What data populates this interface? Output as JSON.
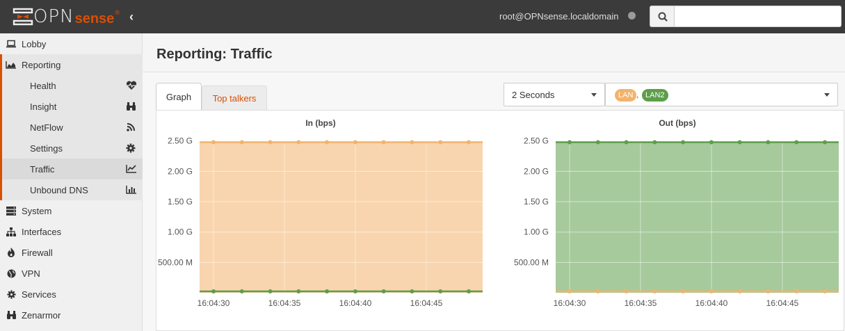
{
  "header": {
    "logo_text": "OPN",
    "logo_sub": "sense",
    "logo_reg": "®",
    "collapse_glyph": "‹",
    "user": "root@OPNsense.localdomain",
    "search_placeholder": ""
  },
  "sidebar": {
    "items": [
      {
        "label": "Lobby",
        "icon": "laptop-icon"
      },
      {
        "label": "Reporting",
        "icon": "area-chart-icon"
      },
      {
        "label": "System",
        "icon": "server-icon"
      },
      {
        "label": "Interfaces",
        "icon": "sitemap-icon"
      },
      {
        "label": "Firewall",
        "icon": "fire-icon"
      },
      {
        "label": "VPN",
        "icon": "globe-icon"
      },
      {
        "label": "Services",
        "icon": "cog-icon"
      },
      {
        "label": "Zenarmor",
        "icon": "binoculars-icon"
      }
    ],
    "reporting_sub": [
      {
        "label": "Health",
        "icon": "heartbeat-icon"
      },
      {
        "label": "Insight",
        "icon": "binoculars-icon"
      },
      {
        "label": "NetFlow",
        "icon": "rss-icon"
      },
      {
        "label": "Settings",
        "icon": "cog-icon"
      },
      {
        "label": "Traffic",
        "icon": "line-chart-icon",
        "active": true
      },
      {
        "label": "Unbound DNS",
        "icon": "bar-chart-icon"
      }
    ]
  },
  "page": {
    "title": "Reporting: Traffic",
    "tabs": [
      {
        "label": "Graph",
        "active": true
      },
      {
        "label": "Top talkers",
        "active": false
      }
    ],
    "interval": "2 Seconds",
    "interfaces": [
      "LAN",
      "LAN2"
    ],
    "interfaces_separator": ","
  },
  "colors": {
    "accent": "#d94f00",
    "lan": "#f2b36c",
    "lan2": "#5d9e4a"
  },
  "chart_data": [
    {
      "type": "area",
      "title": "In (bps)",
      "yticks": [
        "2.50 G",
        "2.00 G",
        "1.50 G",
        "1.00 G",
        "500.00 M"
      ],
      "xticks": [
        "16:04:30",
        "16:04:35",
        "16:04:40",
        "16:04:45"
      ],
      "ylim": [
        0,
        2600000000
      ],
      "x": [
        "16:04:30",
        "16:04:32",
        "16:04:34",
        "16:04:36",
        "16:04:38",
        "16:04:40",
        "16:04:42",
        "16:04:44",
        "16:04:46",
        "16:04:48"
      ],
      "series": [
        {
          "name": "LAN",
          "color": "#f2b36c",
          "values": [
            2480000000,
            2480000000,
            2480000000,
            2480000000,
            2480000000,
            2480000000,
            2480000000,
            2480000000,
            2480000000,
            2480000000
          ]
        },
        {
          "name": "LAN2",
          "color": "#5d9e4a",
          "values": [
            0,
            0,
            0,
            0,
            0,
            0,
            0,
            0,
            0,
            0
          ]
        }
      ]
    },
    {
      "type": "area",
      "title": "Out (bps)",
      "yticks": [
        "2.50 G",
        "2.00 G",
        "1.50 G",
        "1.00 G",
        "500.00 M"
      ],
      "xticks": [
        "16:04:30",
        "16:04:35",
        "16:04:40",
        "16:04:45"
      ],
      "ylim": [
        0,
        2600000000
      ],
      "x": [
        "16:04:30",
        "16:04:32",
        "16:04:34",
        "16:04:36",
        "16:04:38",
        "16:04:40",
        "16:04:42",
        "16:04:44",
        "16:04:46",
        "16:04:48"
      ],
      "series": [
        {
          "name": "LAN2",
          "color": "#5d9e4a",
          "values": [
            2480000000,
            2480000000,
            2480000000,
            2480000000,
            2480000000,
            2480000000,
            2480000000,
            2480000000,
            2480000000,
            2480000000
          ]
        },
        {
          "name": "LAN",
          "color": "#f2b36c",
          "values": [
            0,
            0,
            0,
            0,
            0,
            0,
            0,
            0,
            0,
            0
          ]
        }
      ]
    }
  ]
}
